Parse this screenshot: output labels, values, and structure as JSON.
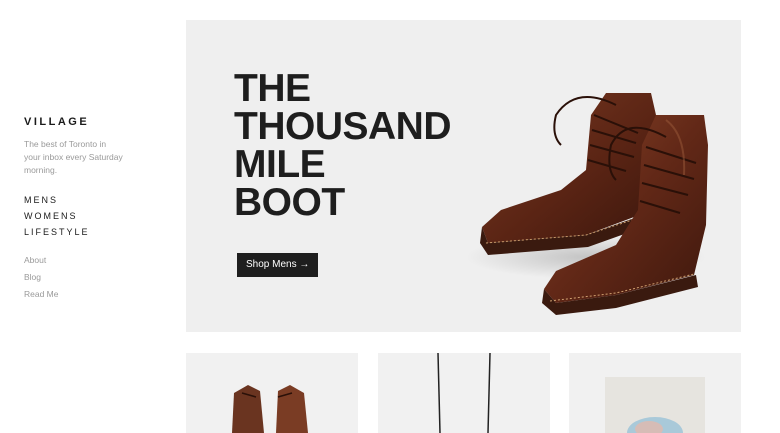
{
  "sidebar": {
    "brand": "VILLAGE",
    "tagline": "The best of Toronto in your inbox every Saturday morning.",
    "nav_main": [
      "MENS",
      "WOMENS",
      "LIFESTYLE"
    ],
    "nav_secondary": [
      "About",
      "Blog",
      "Read Me"
    ]
  },
  "hero": {
    "title_lines": [
      "THE",
      "THOUSAND",
      "MILE",
      "BOOT"
    ],
    "button_label": "Shop Mens →"
  },
  "products": [
    {
      "image": "brown-shoes-image"
    },
    {
      "image": "necklace-image"
    },
    {
      "image": "art-print-image"
    }
  ]
}
